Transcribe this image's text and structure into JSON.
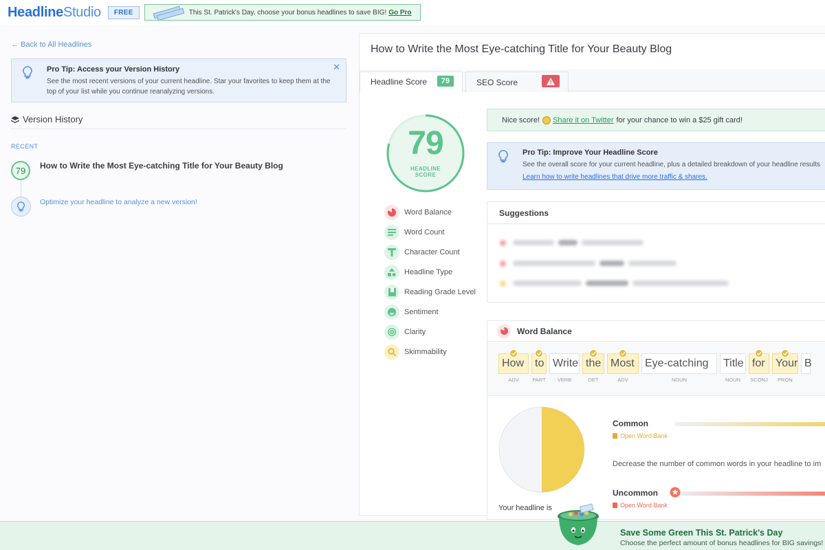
{
  "header": {
    "logo_bold": "Headline",
    "logo_light": "Studio",
    "plan_badge": "FREE",
    "promo_text": "This St. Patrick's Day, choose your bonus headlines to save BIG!",
    "promo_link": "Go Pro"
  },
  "sidebar": {
    "back_link": "← Back to All Headlines",
    "protip": {
      "title": "Pro Tip: Access your Version History",
      "text": "See the most recent versions of your current headline. Star your favorites to keep them at the top of your list while you continue reanalyzing versions.",
      "close": "✕"
    },
    "version_history_title": "Version History",
    "recent_label": "RECENT",
    "versions": [
      {
        "score": "79",
        "title": "How to Write the Most Eye-catching Title for Your Beauty Blog"
      }
    ],
    "optimize_prompt": "Optimize your headline to analyze a new version!"
  },
  "main": {
    "headline": "How to Write the Most Eye-catching Title for Your Beauty Blog",
    "tabs": [
      {
        "label": "Headline Score",
        "badge": "79"
      },
      {
        "label": "SEO Score",
        "badge": "!"
      }
    ],
    "score": {
      "value": "79",
      "label_line1": "HEADLINE",
      "label_line2": "SCORE",
      "fraction": 0.79,
      "color": "#5ec38c"
    },
    "metrics": [
      {
        "label": "Word Balance",
        "icon": "pie-icon"
      },
      {
        "label": "Word Count",
        "icon": "lines-icon"
      },
      {
        "label": "Character Count",
        "icon": "letter-t-icon"
      },
      {
        "label": "Headline Type",
        "icon": "shapes-icon"
      },
      {
        "label": "Reading Grade Level",
        "icon": "book-icon"
      },
      {
        "label": "Sentiment",
        "icon": "smile-icon"
      },
      {
        "label": "Clarity",
        "icon": "target-icon"
      },
      {
        "label": "Skimmability",
        "icon": "magnifier-icon"
      }
    ],
    "nice_banner": {
      "before": "Nice score!",
      "link": "Share it on Twitter",
      "after": "for your chance to win a $25 gift card!"
    },
    "protip": {
      "title": "Pro Tip: Improve Your Headline Score",
      "text": "See the overall score for your current headline, plus a detailed breakdown of your headline results",
      "link": "Learn how to write headlines that drive more traffic & shares."
    },
    "suggestions_title": "Suggestions",
    "word_balance": {
      "title": "Word Balance",
      "tokens": [
        {
          "word": "How",
          "pos": "ADV",
          "common": true
        },
        {
          "word": "to",
          "pos": "PART",
          "common": true
        },
        {
          "word": "Write",
          "pos": "VERB",
          "common": false
        },
        {
          "word": "the",
          "pos": "DET",
          "common": true
        },
        {
          "word": "Most",
          "pos": "ADV",
          "common": true
        },
        {
          "word": "Eye-catching",
          "pos": "NOUN",
          "common": false
        },
        {
          "word": "Title",
          "pos": "NOUN",
          "common": false
        },
        {
          "word": "for",
          "pos": "SCONJ",
          "common": true
        },
        {
          "word": "Your",
          "pos": "PRON",
          "common": true
        },
        {
          "word": "B",
          "pos": "",
          "common": false
        }
      ],
      "common": {
        "label": "Common",
        "link": "Open Word Bank"
      },
      "uncommon": {
        "label": "Uncommon",
        "link": "Open Word Bank"
      },
      "description": "Decrease the number of common words in your headline to im",
      "footer": "Your headline is",
      "pie_fraction": 0.5,
      "colors": {
        "common": "#f2cf55",
        "uncommon": "#f4735e",
        "pie_rest": "#f4f5f8"
      }
    }
  },
  "bottom_promo": {
    "title": "Save Some Green This St. Patrick's Day",
    "subtitle": "Choose the perfect amount of bonus headlines for BIG savings!"
  }
}
